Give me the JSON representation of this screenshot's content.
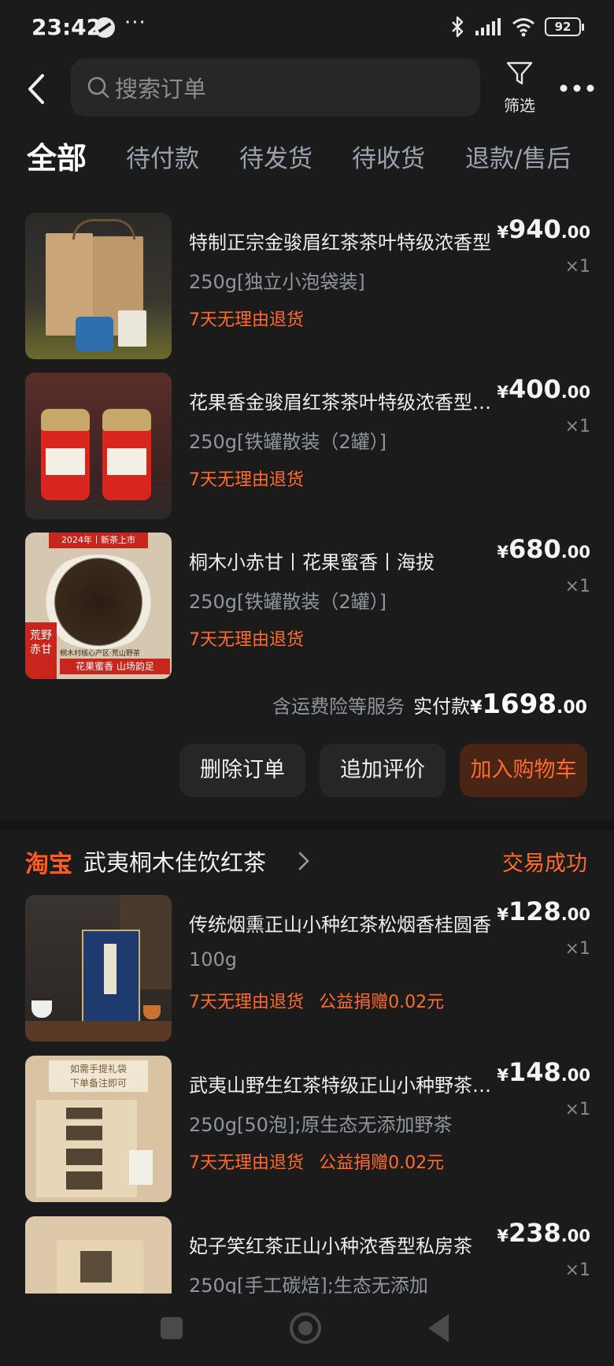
{
  "status_bar": {
    "time": "23:42",
    "more": "···",
    "battery": "92"
  },
  "search": {
    "placeholder": "搜索订单"
  },
  "filter": {
    "label": "筛选"
  },
  "tabs": [
    {
      "label": "全部",
      "active": true
    },
    {
      "label": "待付款"
    },
    {
      "label": "待发货"
    },
    {
      "label": "待收货"
    },
    {
      "label": "退款/售后"
    }
  ],
  "order1": {
    "items": [
      {
        "title": "特制正宗金骏眉红茶茶叶特级浓香型",
        "price_int": "940",
        "price_dec": ".00",
        "currency": "¥",
        "qty": "×1",
        "spec": "250g[独立小泡袋装]",
        "tags": [
          "7天无理由退货"
        ]
      },
      {
        "title": "花果香金骏眉红茶茶叶特级浓香型养胃",
        "price_int": "400",
        "price_dec": ".00",
        "currency": "¥",
        "qty": "×1",
        "spec": "250g[铁罐散装（2罐）]",
        "tags": [
          "7天无理由退货"
        ]
      },
      {
        "title": "桐木小赤甘丨花果蜜香丨海拔",
        "price_int": "680",
        "price_dec": ".00",
        "currency": "¥",
        "qty": "×1",
        "spec": "250g[铁罐散装（2罐）]",
        "tags": [
          "7天无理由退货"
        ],
        "thumb_text": {
          "banner": "2024年丨新茶上市",
          "left_tag": "荒野赤甘",
          "bottom": "花果蜜香  山场韵足",
          "origin": "桐木村核心产区·荒山野茶"
        }
      }
    ],
    "summary": {
      "note": "含运费险等服务",
      "label": "实付款",
      "currency": "¥",
      "amount_int": "1698",
      "amount_dec": ".00"
    },
    "buttons": {
      "delete": "删除订单",
      "review": "追加评价",
      "add_cart": "加入购物车"
    }
  },
  "order2": {
    "platform": "淘宝",
    "shop_name": "武夷桐木佳饮红茶",
    "status": "交易成功",
    "items": [
      {
        "title": "传统烟熏正山小种红茶松烟香桂圆香",
        "price_int": "128",
        "price_dec": ".00",
        "currency": "¥",
        "qty": "×1",
        "spec": "100g",
        "tags": [
          "7天无理由退货",
          "公益捐赠0.02元"
        ]
      },
      {
        "title": "武夷山野生红茶特级正山小种野茶浓香",
        "price_int": "148",
        "price_dec": ".00",
        "currency": "¥",
        "qty": "×1",
        "spec": "250g[50泡];原生态无添加野茶",
        "tags": [
          "7天无理由退货",
          "公益捐赠0.02元"
        ],
        "thumb_text": {
          "banner": "如需手提礼袋\n下单备注即可"
        }
      },
      {
        "title": "妃子笑红茶正山小种浓香型私房茶",
        "price_int": "238",
        "price_dec": ".00",
        "currency": "¥",
        "qty": "×1",
        "spec": "250g[手工碳焙];生态无添加",
        "tags": []
      }
    ]
  }
}
